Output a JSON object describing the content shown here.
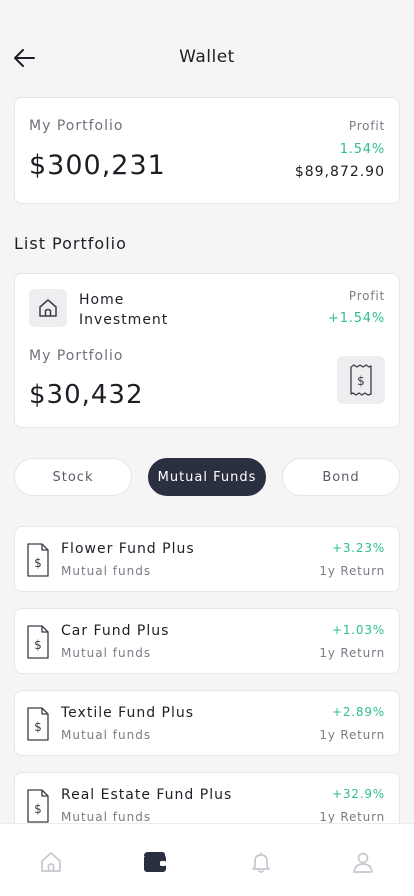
{
  "header": {
    "title": "Wallet",
    "back_icon": "arrow-left-icon"
  },
  "summary": {
    "label": "My Portfolio",
    "amount": "$300,231",
    "profit_label": "Profit",
    "profit_percent": "1.54%",
    "profit_value": "$89,872.90"
  },
  "list_title": "List Portfolio",
  "investment": {
    "icon": "home-icon",
    "name": "Home Investment",
    "profit_label": "Profit",
    "profit_percent": "+1.54%",
    "portfolio_label": "My Portfolio",
    "amount": "$30,432",
    "doc_icon": "dollar-document-icon"
  },
  "tabs": [
    {
      "label": "Stock",
      "active": false
    },
    {
      "label": "Mutual Funds",
      "active": true
    },
    {
      "label": "Bond",
      "active": false
    }
  ],
  "funds": [
    {
      "name": "Flower Fund Plus",
      "type": "Mutual funds",
      "return": "+3.23%",
      "period": "1y Return"
    },
    {
      "name": "Car Fund Plus",
      "type": "Mutual funds",
      "return": "+1.03%",
      "period": "1y Return"
    },
    {
      "name": "Textile Fund Plus",
      "type": "Mutual funds",
      "return": "+2.89%",
      "period": "1y Return"
    },
    {
      "name": "Real Estate Fund Plus",
      "type": "Mutual funds",
      "return": "+32.9%",
      "period": "1y Return"
    }
  ],
  "nav": [
    {
      "icon": "home-icon",
      "active": false
    },
    {
      "icon": "wallet-icon",
      "active": true
    },
    {
      "icon": "bell-icon",
      "active": false
    },
    {
      "icon": "user-icon",
      "active": false
    }
  ],
  "colors": {
    "positive": "#2fbf8a",
    "accent_dark": "#2b3040",
    "background": "#f5f5f6"
  }
}
